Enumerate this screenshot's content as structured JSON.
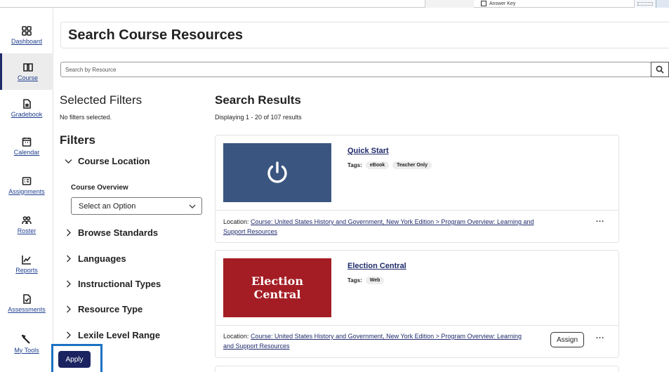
{
  "topbar": {
    "checkbox_label": "Answer Key"
  },
  "sidebar": {
    "items": [
      {
        "label": "Dashboard",
        "icon": "dashboard-icon"
      },
      {
        "label": "Course",
        "icon": "book-icon",
        "active": true
      },
      {
        "label": "Gradebook",
        "icon": "gradebook-icon"
      },
      {
        "label": "Calendar",
        "icon": "calendar-icon"
      },
      {
        "label": "Assignments",
        "icon": "assignments-icon"
      },
      {
        "label": "Roster",
        "icon": "roster-icon"
      },
      {
        "label": "Reports",
        "icon": "reports-icon"
      },
      {
        "label": "Assessments",
        "icon": "assessments-icon"
      },
      {
        "label": "My Tools",
        "icon": "wrench-icon"
      }
    ]
  },
  "page": {
    "title": "Search Course Resources"
  },
  "search": {
    "placeholder": "Search by Resource"
  },
  "filters_panel": {
    "selected_heading": "Selected Filters",
    "no_filters": "No filters selected.",
    "filters_heading": "Filters",
    "course_location": "Course Location",
    "course_overview_label": "Course Overview",
    "select_placeholder": "Select an Option",
    "groups": [
      "Browse Standards",
      "Languages",
      "Instructional Types",
      "Resource Type",
      "Lexile Level Range"
    ],
    "apply_label": "Apply"
  },
  "results": {
    "heading": "Search Results",
    "count_text": "Displaying 1 - 20 of 107 results",
    "tags_label": "Tags:",
    "location_label": "Location:",
    "items": [
      {
        "title": "Quick Start",
        "tags": [
          "eBook",
          "Teacher Only"
        ],
        "thumb_color": "#3a5680",
        "location_link": "Course: United States History and Government, New York Edition > Program Overview: Learning and Support Resources",
        "more_label": "..."
      },
      {
        "title": "Election Central",
        "tags": [
          "Web"
        ],
        "thumb_color": "#a41d24",
        "thumb_line1": "Election",
        "thumb_line2": "Central",
        "location_link": "Course: United States History and Government, New York Edition > Program Overview: Learning and Support Resources",
        "assign_label": "Assign",
        "more_label": "..."
      }
    ]
  }
}
